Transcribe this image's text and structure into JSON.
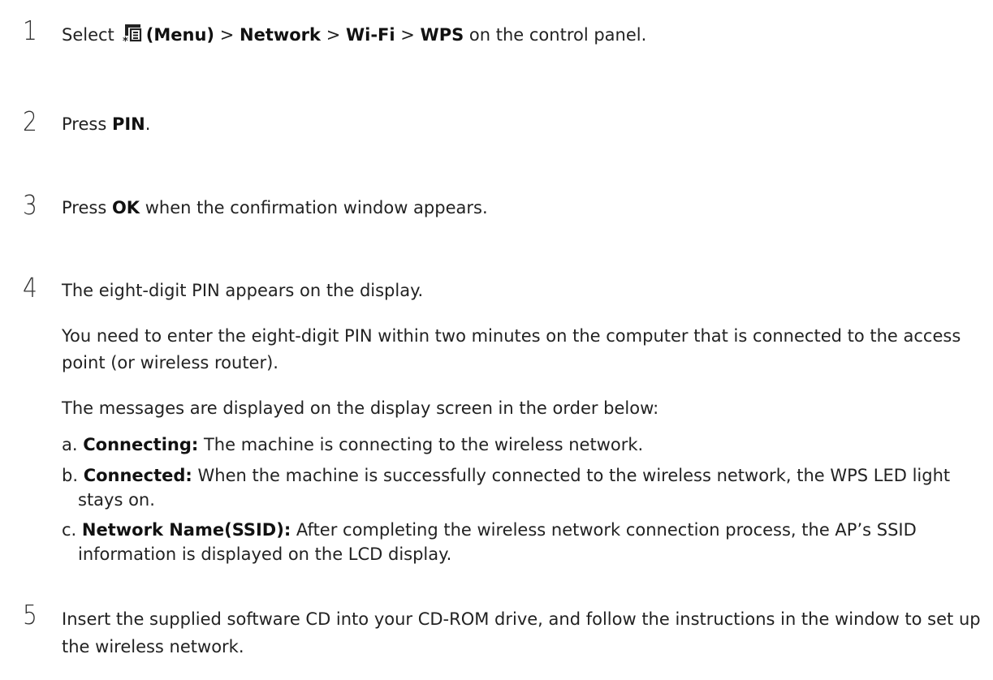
{
  "steps": [
    {
      "number": "1",
      "select": "Select",
      "menu_label": "(Menu)",
      "sep": " > ",
      "network": "Network",
      "wifi": "Wi-Fi",
      "wps": "WPS",
      "rest": " on the control panel."
    },
    {
      "number": "2",
      "pre": "Press ",
      "bold": "PIN",
      "post": "."
    },
    {
      "number": "3",
      "pre": "Press ",
      "bold": "OK",
      "post": " when the confirmation window appears."
    },
    {
      "number": "4",
      "text": "The eight-digit PIN appears on the display.",
      "para1": "You need to enter the eight-digit PIN within two minutes on the computer that is connected to the access point (or wireless router).",
      "para2": "The messages are displayed on the display screen in the order below:",
      "list": [
        {
          "marker": "a. ",
          "term": "Connecting:",
          "desc": " The machine is connecting to the wireless network."
        },
        {
          "marker": "b. ",
          "term": "Connected:",
          "desc": " When the machine is successfully connected to the wireless network, the WPS LED light stays on."
        },
        {
          "marker": "c. ",
          "term": "Network Name(SSID):",
          "desc": " After completing the wireless network connection process, the AP’s SSID information is displayed on the LCD display."
        }
      ]
    },
    {
      "number": "5",
      "text": "Insert the supplied software CD into your CD-ROM drive, and follow the instructions in the window to set up the wireless network."
    }
  ],
  "icons": {
    "menu": "menu-icon"
  }
}
